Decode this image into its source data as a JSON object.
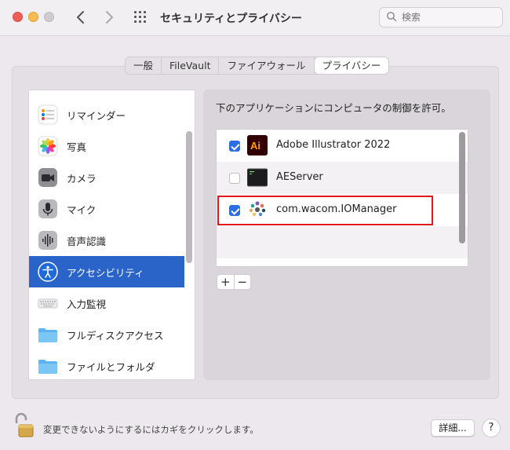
{
  "window": {
    "title": "セキュリティとプライバシー"
  },
  "search": {
    "placeholder": "検索"
  },
  "tabs": [
    {
      "label": "一般",
      "active": false
    },
    {
      "label": "FileVault",
      "active": false
    },
    {
      "label": "ファイアウォール",
      "active": false
    },
    {
      "label": "プライバシー",
      "active": true
    }
  ],
  "sidebar": {
    "items": [
      {
        "label": "リマインダー",
        "icon": "reminders-icon"
      },
      {
        "label": "写真",
        "icon": "photos-icon"
      },
      {
        "label": "カメラ",
        "icon": "camera-icon"
      },
      {
        "label": "マイク",
        "icon": "microphone-icon"
      },
      {
        "label": "音声認識",
        "icon": "speech-recognition-icon"
      },
      {
        "label": "アクセシビリティ",
        "icon": "accessibility-icon",
        "selected": true
      },
      {
        "label": "入力監視",
        "icon": "keyboard-icon"
      },
      {
        "label": "フルディスクアクセス",
        "icon": "folder-icon"
      },
      {
        "label": "ファイルとフォルダ",
        "icon": "folder-icon"
      }
    ]
  },
  "main": {
    "description": "下のアプリケーションにコンピュータの制御を許可。",
    "apps": [
      {
        "name": "Adobe Illustrator 2022",
        "checked": true,
        "icon": "illustrator-icon"
      },
      {
        "name": "AEServer",
        "checked": false,
        "icon": "terminal-app-icon"
      },
      {
        "name": "com.wacom.IOManager",
        "checked": true,
        "icon": "wacom-icon"
      }
    ],
    "add_label": "+",
    "remove_label": "−"
  },
  "footer": {
    "lock_text": "変更できないようにするにはカギをクリックします。",
    "advanced_label": "詳細...",
    "help_label": "?"
  },
  "colors": {
    "accent": "#2a64c9",
    "highlight_box": "#e0191f"
  }
}
